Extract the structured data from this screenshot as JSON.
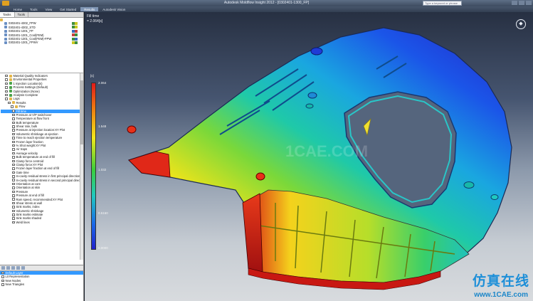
{
  "window": {
    "title": "Autodesk Moldflow Insight 2012 - [0302401-1300_FP]",
    "search_placeholder": "Type a keyword or phrase"
  },
  "ribbon": {
    "tabs": [
      "Home",
      "Tools",
      "View",
      "Get Started",
      "Results",
      "Autodesk Vision"
    ],
    "active_tab": "Results"
  },
  "panel_tabs": [
    "Tasks",
    "Tools"
  ],
  "studies": [
    {
      "label": "0302401-4302_FPW"
    },
    {
      "label": "0302401-4302_STD"
    },
    {
      "label": "0302401-1301_FP"
    },
    {
      "label": "0302401-1301_Cool(FEM)"
    },
    {
      "label": "0302401-1301_Cool(FEM)-FPW"
    },
    {
      "label": "0302401-1301_FPWV"
    }
  ],
  "study_tree": [
    {
      "label": "Material Quality Indicators",
      "icon": "folder"
    },
    {
      "label": "Environmental Properties",
      "icon": "folder"
    },
    {
      "label": "1 Injection Location(s)",
      "icon": "green"
    },
    {
      "label": "Process Settings (Default)",
      "icon": "green"
    },
    {
      "label": "Optimization (None)",
      "icon": "green"
    },
    {
      "label": "Analysis Complete",
      "icon": "green"
    },
    {
      "label": "Logs",
      "icon": "folder"
    },
    {
      "label": "Results",
      "icon": "folder"
    },
    {
      "label": "Flow",
      "icon": "folder"
    }
  ],
  "results": [
    {
      "label": "Fill time",
      "selected": true
    },
    {
      "label": "Pressure at V/P switchover"
    },
    {
      "label": "Temperature at flow front"
    },
    {
      "label": "Bulk temperature"
    },
    {
      "label": "Shear rate, bulk"
    },
    {
      "label": "Pressure at injection location:XY Plot"
    },
    {
      "label": "Volumetric shrinkage at ejection"
    },
    {
      "label": "Time to reach ejection temperature"
    },
    {
      "label": "Frozen layer fraction"
    },
    {
      "label": "% Shot weight:XY Plot"
    },
    {
      "label": "Air traps"
    },
    {
      "label": "Average velocity"
    },
    {
      "label": "Bulk temperature at end of fill"
    },
    {
      "label": "Clamp force centroid"
    },
    {
      "label": "Clamp force:XY Plot"
    },
    {
      "label": "Frozen layer fraction at end of fill"
    },
    {
      "label": "Gate time"
    },
    {
      "label": "In-cavity residual stress in first principal direction"
    },
    {
      "label": "In-cavity residual stress in second principal direction"
    },
    {
      "label": "Orientation at core"
    },
    {
      "label": "Orientation at skin"
    },
    {
      "label": "Pressure"
    },
    {
      "label": "Pressure at end of fill"
    },
    {
      "label": "Ram speed, recommended:XY Plot"
    },
    {
      "label": "Shear stress at wall"
    },
    {
      "label": "Sink marks, index"
    },
    {
      "label": "Volumetric shrinkage"
    },
    {
      "label": "Sink marks estimate"
    },
    {
      "label": "Sink marks shaded"
    },
    {
      "label": "Weld lines"
    }
  ],
  "layers": [
    {
      "label": "Default Layer",
      "selected": true
    },
    {
      "label": "Lit Representation"
    },
    {
      "label": "New Nodes"
    },
    {
      "label": "New Triangles"
    }
  ],
  "viewport": {
    "result_title": "Fill time",
    "result_sub": "= 2.064[s]",
    "legend_unit": "[s]",
    "legend_ticks": [
      "2.064",
      "1.548",
      "1.032",
      "0.5160",
      "0.0000"
    ],
    "center_mark": "1CAE.COM"
  },
  "colors": {
    "legend_max": "#e21a1a",
    "legend_min": "#2222cc",
    "selection": "#3399ff"
  },
  "watermark": {
    "cn": "仿真在线",
    "url": "www.1CAE.com"
  }
}
